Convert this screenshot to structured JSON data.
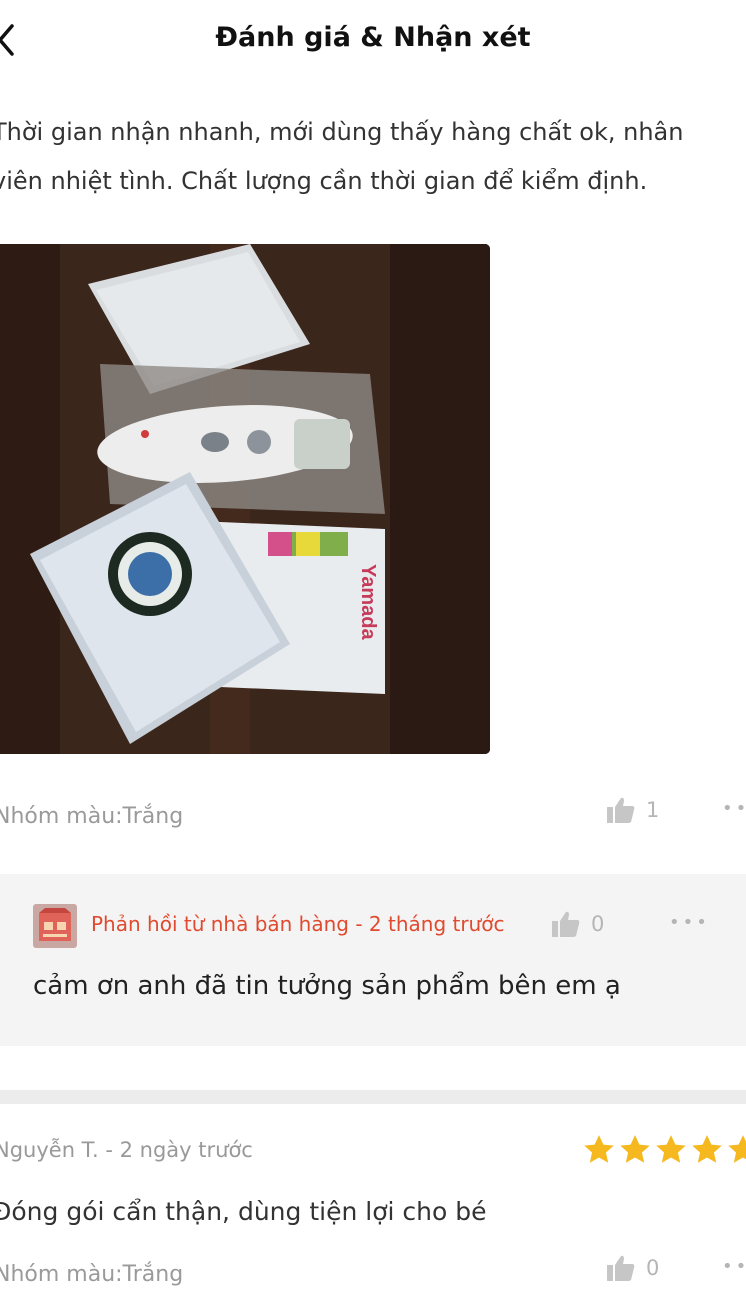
{
  "header": {
    "title": "Đánh giá & Nhận xét",
    "back_icon": "chevron-left-icon"
  },
  "review1": {
    "text_line1": "Thời gian nhận nhanh, mới dùng thấy hàng chất ok, nhân",
    "text_line2": "viên nhiệt tình. Chất lượng cần thời gian để kiểm định.",
    "variant": "Nhóm màu:Trắng",
    "like_count": "1",
    "more_label": "••",
    "photo_label": "Yamada",
    "reply": {
      "header": "Phản hồi từ nhà bán hàng - 2 tháng trước",
      "like_count": "0",
      "more_label": "•••",
      "text": "cảm ơn anh đã tin tưởng sản phẩm bên em ạ"
    }
  },
  "review2": {
    "reviewer": "Nguyễn T. - 2 ngày trước",
    "rating": 5,
    "text": "Đóng gói cẩn thận, dùng tiện lợi cho bé",
    "variant": "Nhóm màu:Trắng",
    "like_count": "0",
    "more_label": "••"
  },
  "colors": {
    "accent": "#e04a2f",
    "star": "#f5b91f",
    "muted": "#9a9a9a"
  }
}
